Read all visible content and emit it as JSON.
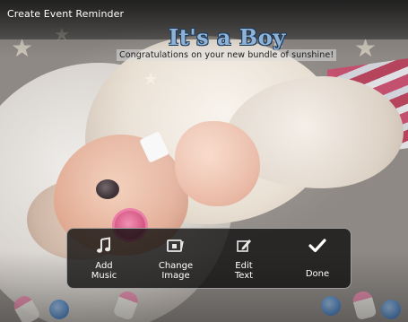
{
  "app": {
    "title": "Create Event Reminder"
  },
  "card": {
    "headline": "It's a Boy",
    "message": "Congratulations on your new bundle of sunshine!"
  },
  "actions": [
    {
      "id": "add-music",
      "icon": "music-note-icon",
      "line1": "Add",
      "line2": "Music"
    },
    {
      "id": "change-image",
      "icon": "image-frame-icon",
      "line1": "Change",
      "line2": "Image"
    },
    {
      "id": "edit-text",
      "icon": "edit-pencil-icon",
      "line1": "Edit",
      "line2": "Text"
    },
    {
      "id": "done",
      "icon": "checkmark-icon",
      "line1": "Done"
    }
  ],
  "colors": {
    "headline": "#8fb3d6",
    "panel_bg": "#0c0c0c",
    "text": "#ffffff"
  }
}
